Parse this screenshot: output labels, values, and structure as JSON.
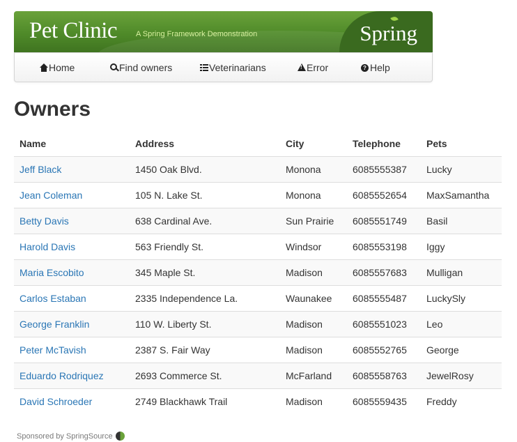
{
  "header": {
    "title": "Pet Clinic",
    "subtitle": "A Spring Framework Demonstration",
    "brand": "Spring",
    "brand_color": "#4f8a29"
  },
  "nav": {
    "items": [
      {
        "label": "Home",
        "icon": "home-icon"
      },
      {
        "label": "Find owners",
        "icon": "search-icon"
      },
      {
        "label": "Veterinarians",
        "icon": "list-icon"
      },
      {
        "label": "Error",
        "icon": "warning-icon"
      },
      {
        "label": "Help",
        "icon": "help-icon"
      }
    ]
  },
  "page": {
    "title": "Owners"
  },
  "table": {
    "columns": [
      "Name",
      "Address",
      "City",
      "Telephone",
      "Pets"
    ],
    "rows": [
      {
        "name": "Jeff Black",
        "address": "1450 Oak Blvd.",
        "city": "Monona",
        "telephone": "6085555387",
        "pets": "Lucky"
      },
      {
        "name": "Jean Coleman",
        "address": "105 N. Lake St.",
        "city": "Monona",
        "telephone": "6085552654",
        "pets": "MaxSamantha"
      },
      {
        "name": "Betty Davis",
        "address": "638 Cardinal Ave.",
        "city": "Sun Prairie",
        "telephone": "6085551749",
        "pets": "Basil"
      },
      {
        "name": "Harold Davis",
        "address": "563 Friendly St.",
        "city": "Windsor",
        "telephone": "6085553198",
        "pets": "Iggy"
      },
      {
        "name": "Maria Escobito",
        "address": "345 Maple St.",
        "city": "Madison",
        "telephone": "6085557683",
        "pets": "Mulligan"
      },
      {
        "name": "Carlos Estaban",
        "address": "2335 Independence La.",
        "city": "Waunakee",
        "telephone": "6085555487",
        "pets": "LuckySly"
      },
      {
        "name": "George Franklin",
        "address": "110 W. Liberty St.",
        "city": "Madison",
        "telephone": "6085551023",
        "pets": "Leo"
      },
      {
        "name": "Peter McTavish",
        "address": "2387 S. Fair Way",
        "city": "Madison",
        "telephone": "6085552765",
        "pets": "George"
      },
      {
        "name": "Eduardo Rodriquez",
        "address": "2693 Commerce St.",
        "city": "McFarland",
        "telephone": "6085558763",
        "pets": "JewelRosy"
      },
      {
        "name": "David Schroeder",
        "address": "2749 Blackhawk Trail",
        "city": "Madison",
        "telephone": "6085559435",
        "pets": "Freddy"
      }
    ],
    "link_color": "#2a76b5"
  },
  "footer": {
    "text": "Sponsored by SpringSource"
  }
}
